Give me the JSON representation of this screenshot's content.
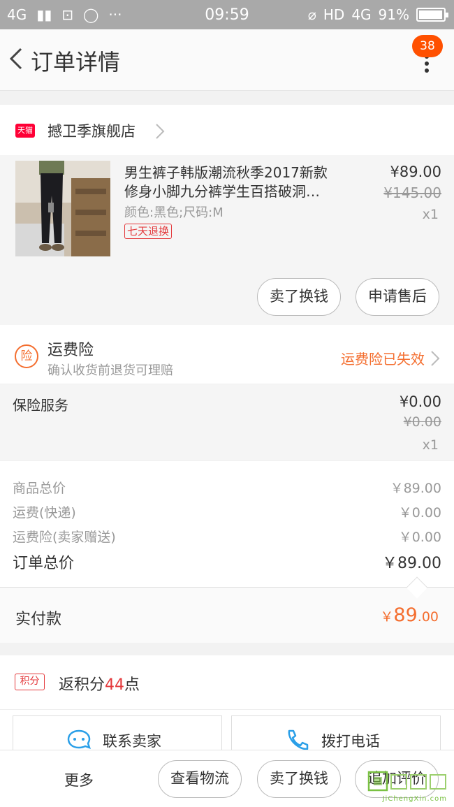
{
  "status_bar": {
    "network_left": "4G",
    "time": "09:59",
    "hd": "HD",
    "network_right": "4G",
    "battery": "91%"
  },
  "nav": {
    "title": "订单详情",
    "badge_count": "38"
  },
  "shop": {
    "badge": "天猫",
    "name": "撼卫季旗舰店"
  },
  "product": {
    "title_line1": "男生裤子韩版潮流秋季2017新款",
    "title_line2": "修身小脚九分裤学生百搭破洞…",
    "spec": "颜色:黑色;尺码:M",
    "tag": "七天退换",
    "price": "¥89.00",
    "original_price": "¥145.00",
    "quantity": "x1",
    "btn_resell": "卖了换钱",
    "btn_aftersale": "申请售后"
  },
  "insurance": {
    "icon_text": "险",
    "title": "运费险",
    "subtitle": "确认收货前退货可理赔",
    "status": "运费险已失效"
  },
  "service": {
    "name": "保险服务",
    "price": "¥0.00",
    "original_price": "¥0.00",
    "quantity": "x1"
  },
  "summary": {
    "rows": [
      {
        "label": "商品总价",
        "value": "￥89.00"
      },
      {
        "label": "运费(快递)",
        "value": "￥0.00"
      },
      {
        "label": "运费险(卖家赠送)",
        "value": "￥0.00"
      }
    ],
    "total_label": "订单总价",
    "total_value": "￥89.00"
  },
  "paid": {
    "label": "实付款",
    "currency": "￥",
    "integer": "89",
    "decimal": ".00"
  },
  "points": {
    "tag": "积分",
    "prefix": "返积分",
    "value": "44",
    "suffix": "点"
  },
  "contact": {
    "seller": "联系卖家",
    "phone": "拨打电话"
  },
  "bottom_bar": {
    "more": "更多",
    "logistics": "查看物流",
    "resell": "卖了换钱",
    "review": "追加评价"
  },
  "watermark": {
    "site": "JiChengXin.com"
  },
  "colors": {
    "accent": "#f46e2f",
    "tmall_red": "#ff0036",
    "badge": "#ff5000"
  }
}
